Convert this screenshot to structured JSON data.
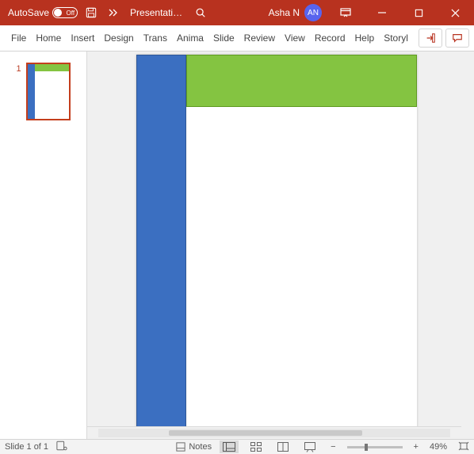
{
  "titlebar": {
    "autosave_label": "AutoSave",
    "autosave_state": "Off",
    "document_title": "Presentati…",
    "user_name": "Asha N",
    "user_initials": "AN"
  },
  "ribbon": {
    "tabs": [
      "File",
      "Home",
      "Insert",
      "Design",
      "Trans",
      "Anima",
      "Slide",
      "Review",
      "View",
      "Record",
      "Help",
      "Storyl"
    ]
  },
  "thumbnails": {
    "item1_number": "1"
  },
  "statusbar": {
    "slide_indicator": "Slide 1 of 1",
    "notes_label": "Notes",
    "zoom_value": "49%",
    "zoom_minus": "−",
    "zoom_plus": "+"
  }
}
